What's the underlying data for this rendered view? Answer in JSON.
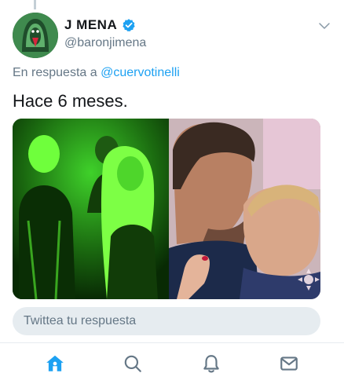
{
  "tweet": {
    "display_name": "J MENA",
    "handle": "@baronjimena",
    "reply_prefix": "En respuesta a",
    "reply_mention": "@cuervotinelli",
    "text": "Hace 6 meses."
  },
  "composer": {
    "placeholder": "Twittea tu respuesta"
  },
  "tabbar": {
    "items": [
      {
        "icon": "home-icon",
        "active": true
      },
      {
        "icon": "search-icon",
        "active": false
      },
      {
        "icon": "bell-icon",
        "active": false
      },
      {
        "icon": "mail-icon",
        "active": false
      }
    ]
  },
  "colors": {
    "accent": "#1da1f2",
    "secondary_text": "#657786",
    "verified": "#1da1f2"
  }
}
